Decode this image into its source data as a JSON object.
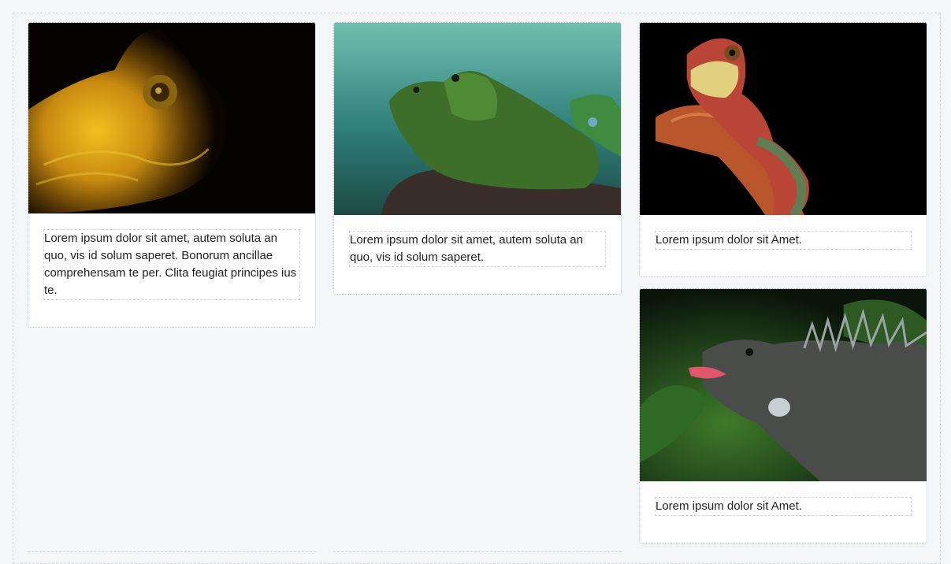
{
  "cards": [
    {
      "image_alt": "Yellow chameleon close-up",
      "text": "Lorem ipsum dolor sit amet, autem soluta an quo, vis id solum saperet. Bonorum ancillae comprehensam te per. Clita feugiat principes ius te."
    },
    {
      "image_alt": "Green iguanas on a rock",
      "text": "Lorem ipsum dolor sit amet, autem soluta an quo, vis id solum saperet."
    },
    {
      "image_alt": "Red chameleon on a branch",
      "text": "Lorem ipsum dolor sit Amet."
    },
    {
      "image_alt": "Dark iguana among leaves",
      "text": "Lorem ipsum dolor sit Amet."
    }
  ]
}
